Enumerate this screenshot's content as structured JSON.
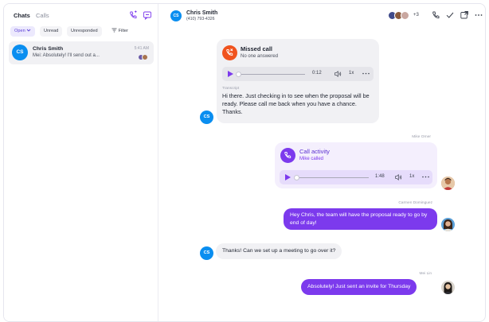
{
  "sidebar": {
    "tabs": [
      "Chats",
      "Calls"
    ],
    "filters": {
      "open": "Open",
      "unread": "Unread",
      "unresponded": "Unresponded",
      "filter": "Filter"
    },
    "conversation": {
      "initials": "CS",
      "name": "Chris Smith",
      "time": "5:41 AM",
      "preview": "Mei: Absolutely! I'll send out a..."
    }
  },
  "header": {
    "initials": "CS",
    "name": "Chris Smith",
    "phone": "(410) 793-4326",
    "participants_extra": "+3"
  },
  "messages": {
    "missed_call": {
      "title": "Missed call",
      "subtitle": "No one answered",
      "duration": "0:12",
      "speed": "1x",
      "transcript_label": "Transcript",
      "transcript": "Hi there. Just checking in to see when the proposal will be ready. Please call me back when you have a chance. Thanks.",
      "initials": "CS"
    },
    "call_activity": {
      "sender": "Mike Orner",
      "title": "Call activity",
      "subtitle": "Mike called",
      "duration": "1:48",
      "speed": "1x"
    },
    "carmen": {
      "sender": "Carmen Dominguez",
      "text": "Hey Chris, the team will have the proposal ready to go by end of day!"
    },
    "chris_reply": {
      "initials": "CS",
      "text": "Thanks! Can we set up a meeting to go over it?"
    },
    "mei": {
      "sender": "Mei Lin",
      "text": "Absolutely! Just sent an invite for Thursday"
    }
  },
  "colors": {
    "accent": "#7c3aed",
    "avatar_blue": "#0a8ef0",
    "missed_orange": "#f0531e",
    "bubble_gray": "#f1f1f4"
  },
  "icons": [
    "new-call-icon",
    "compose-icon",
    "chevron-down-icon",
    "filter-icon",
    "phone-icon",
    "check-icon",
    "open-external-icon",
    "more-icon",
    "missed-call-icon",
    "volume-icon",
    "play-icon"
  ]
}
